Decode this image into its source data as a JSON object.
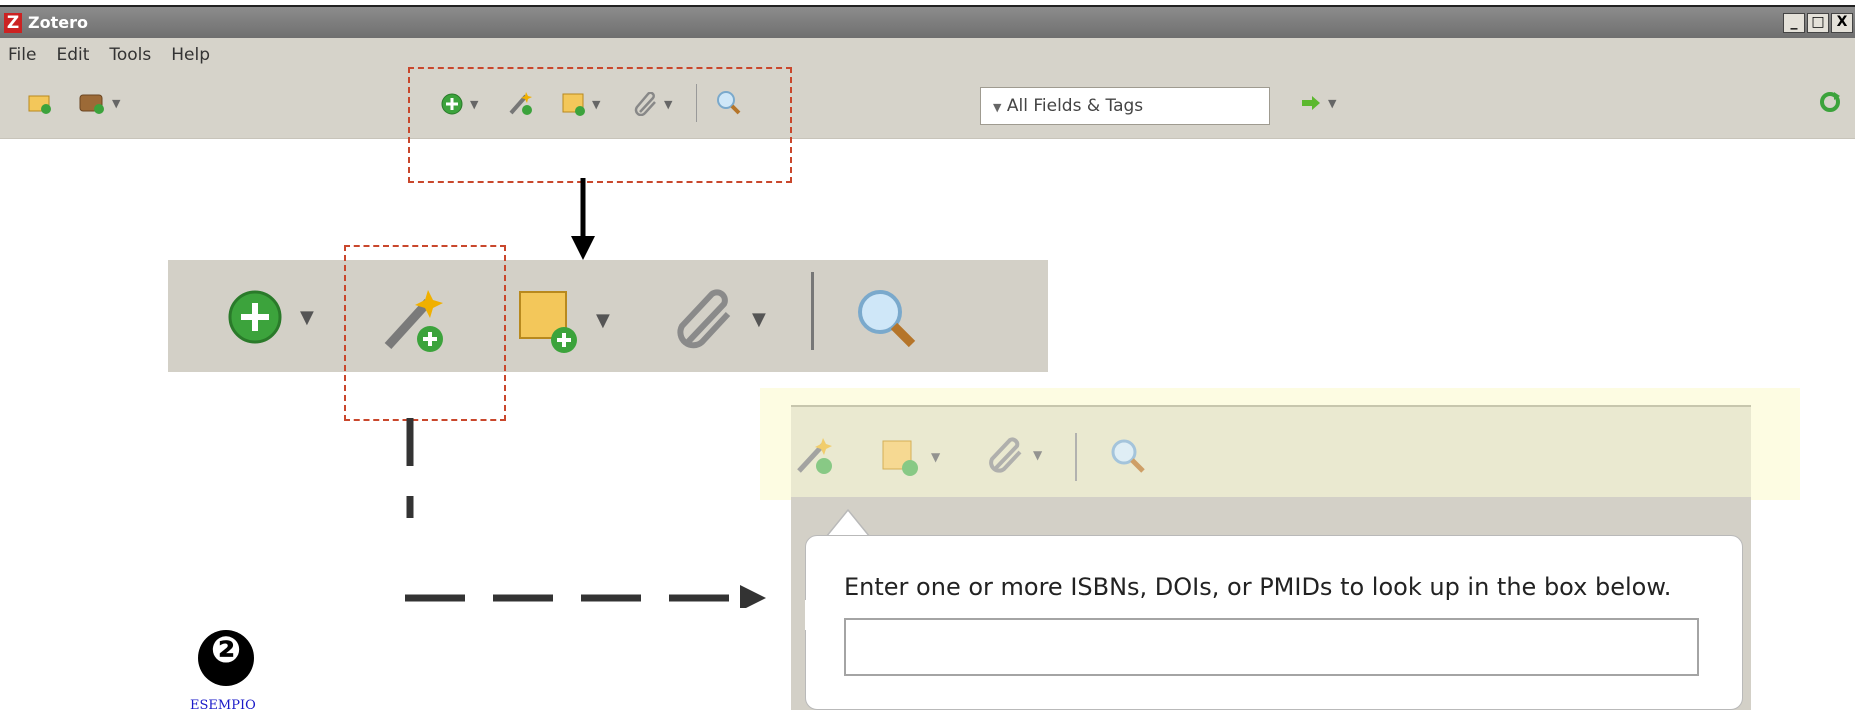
{
  "window": {
    "title": "Zotero",
    "logo_letter": "Z"
  },
  "window_buttons": {
    "minimize": "_",
    "maximize": "□",
    "close": "X"
  },
  "menu": {
    "file": "File",
    "edit": "Edit",
    "tools": "Tools",
    "help": "Help"
  },
  "toolbar": {
    "search_mode": "All Fields & Tags",
    "icons": [
      "new-collection-icon",
      "new-library-icon",
      "new-item-icon",
      "add-by-identifier-icon",
      "new-note-icon",
      "add-attachment-icon",
      "advanced-search-icon",
      "locate-icon",
      "sync-icon"
    ]
  },
  "lookup": {
    "message": "Enter one or more ISBNs, DOIs, or PMIDs to look up in the box below.",
    "input_value": ""
  },
  "annotation": {
    "badge": "❷",
    "caption": "ESEMPIO"
  },
  "colors": {
    "highlight": "#fdfce2",
    "dashed_border": "#c9472c",
    "titlebar": "#6f6f6f",
    "toolbar": "#d6d3ca"
  }
}
